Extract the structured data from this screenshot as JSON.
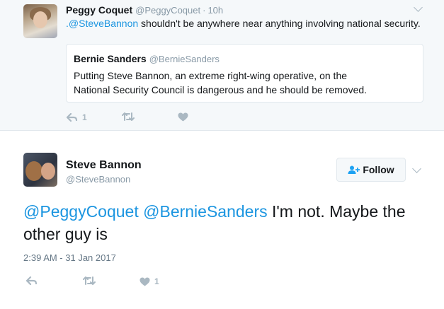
{
  "parent_tweet": {
    "name": "Peggy Coquet",
    "handle": "@PeggyCoquet",
    "separator": "·",
    "time": "10h",
    "mention": ".@SteveBannon",
    "text": " shouldn't be anywhere near anything involving national security.",
    "quoted": {
      "name": "Bernie Sanders",
      "handle": "@BernieSanders",
      "text": "Putting Steve Bannon, an extreme right-wing operative, on the National Security Council is dangerous and he should be removed."
    },
    "actions": {
      "reply_count": "1",
      "retweet_count": "",
      "like_count": ""
    }
  },
  "main_tweet": {
    "name": "Steve Bannon",
    "handle": "@SteveBannon",
    "follow_label": "Follow",
    "mention_1": "@PeggyCoquet",
    "mention_2": "@BernieSanders",
    "text": " I'm not. Maybe the other guy is",
    "timestamp": "2:39 AM - 31 Jan 2017",
    "actions": {
      "reply_count": "",
      "retweet_count": "",
      "like_count": "1"
    }
  },
  "colors": {
    "link": "#1b95e0",
    "muted": "#8899a6",
    "icon": "#aab8c2",
    "follow_icon": "#1da1f2"
  }
}
